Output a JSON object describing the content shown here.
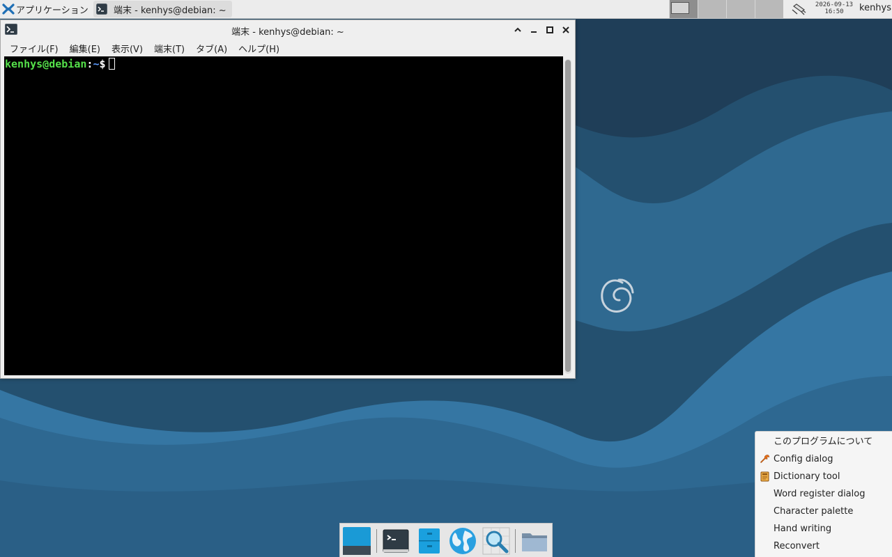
{
  "panel": {
    "apps_menu_label": "アプリケーション",
    "task_label": "端末 - kenhys@debian: ~",
    "clock_date": "2026-09-13",
    "clock_time": "16:50",
    "user": "kenhys",
    "workspace_count": 4,
    "active_workspace": 1
  },
  "terminal": {
    "title": "端末 - kenhys@debian: ~",
    "buttons": {
      "shade": "⌃",
      "minimize": "–",
      "maximize": "□",
      "close": "✕"
    },
    "menu": [
      "ファイル(F)",
      "編集(E)",
      "表示(V)",
      "端末(T)",
      "タブ(A)",
      "ヘルプ(H)"
    ],
    "prompt": {
      "user_host": "kenhys@debian",
      "sep": ":",
      "path": "~",
      "symbol": "$"
    }
  },
  "context_menu": {
    "items": [
      {
        "label": "このプログラムについて",
        "icon": ""
      },
      {
        "label": "Config dialog",
        "icon": "wrench-icon"
      },
      {
        "label": "Dictionary tool",
        "icon": "dictionary-icon"
      },
      {
        "label": "Word register dialog",
        "icon": ""
      },
      {
        "label": "Character palette",
        "icon": ""
      },
      {
        "label": "Hand writing",
        "icon": ""
      },
      {
        "label": "Reconvert",
        "icon": ""
      }
    ]
  },
  "dock": {
    "items": [
      "show-desktop-icon",
      "terminal-icon",
      "file-manager-icon",
      "web-browser-icon",
      "app-finder-icon",
      "folder-icon"
    ]
  },
  "colors": {
    "wallpaper_dark": "#1f3e58",
    "wallpaper_mid": "#2b5f86",
    "wallpaper_light": "#3576a3",
    "prompt_user": "#55e04a",
    "prompt_path": "#5c9bff",
    "wrench": "#e8701a"
  }
}
